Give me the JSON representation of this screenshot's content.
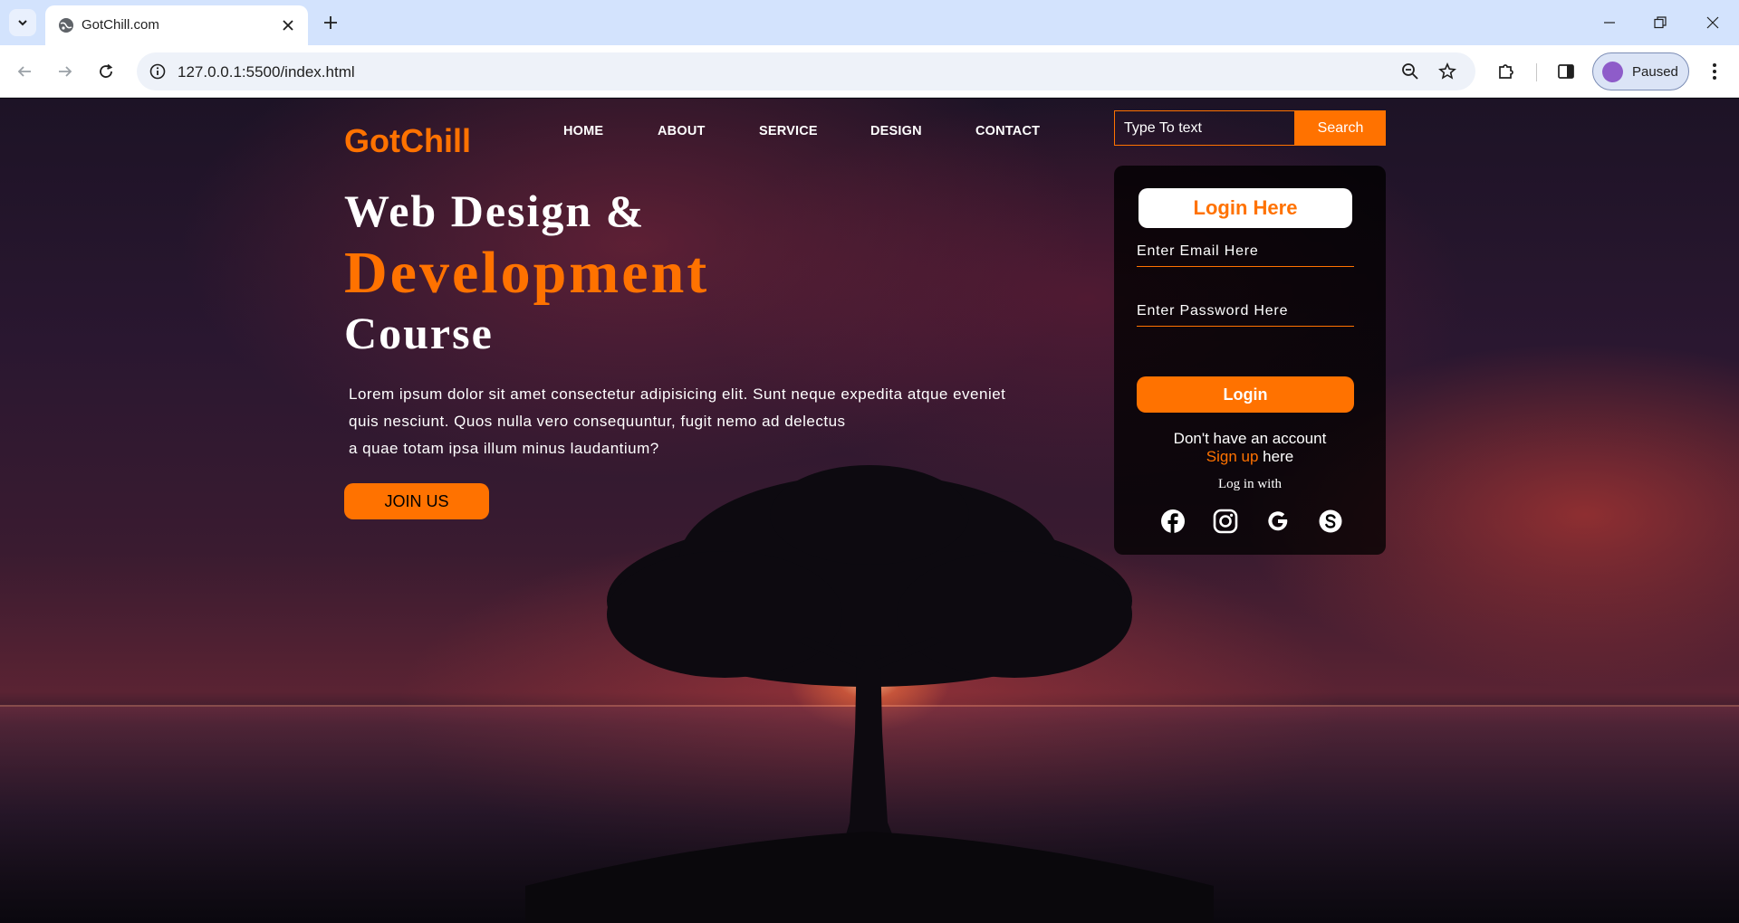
{
  "browser": {
    "tab_title": "GotChill.com",
    "url": "127.0.0.1:5500/index.html",
    "profile_label": "Paused"
  },
  "site": {
    "logo": "GotChill",
    "nav": [
      "HOME",
      "ABOUT",
      "SERVICE",
      "DESIGN",
      "CONTACT"
    ],
    "search": {
      "placeholder": "Type To text",
      "button": "Search"
    },
    "hero": {
      "line1": "Web Design &",
      "line2": "Development",
      "line3": "Course",
      "paragraph": [
        "Lorem ipsum dolor sit amet consectetur adipisicing elit. Sunt neque expedita atque eveniet",
        "quis nesciunt. Quos nulla vero consequuntur, fugit nemo ad delectus",
        "a quae totam ipsa illum minus laudantium?"
      ],
      "cta": "JOIN US"
    },
    "login": {
      "title": "Login Here",
      "email_placeholder": "Enter Email Here",
      "password_placeholder": "Enter Password Here",
      "button": "Login",
      "no_account": "Don't have an account",
      "signup_link": "Sign up",
      "signup_suffix": " here",
      "login_with": "Log in with",
      "socials": [
        "facebook-icon",
        "instagram-icon",
        "google-icon",
        "skype-icon"
      ]
    },
    "colors": {
      "accent": "#ff7200"
    }
  }
}
